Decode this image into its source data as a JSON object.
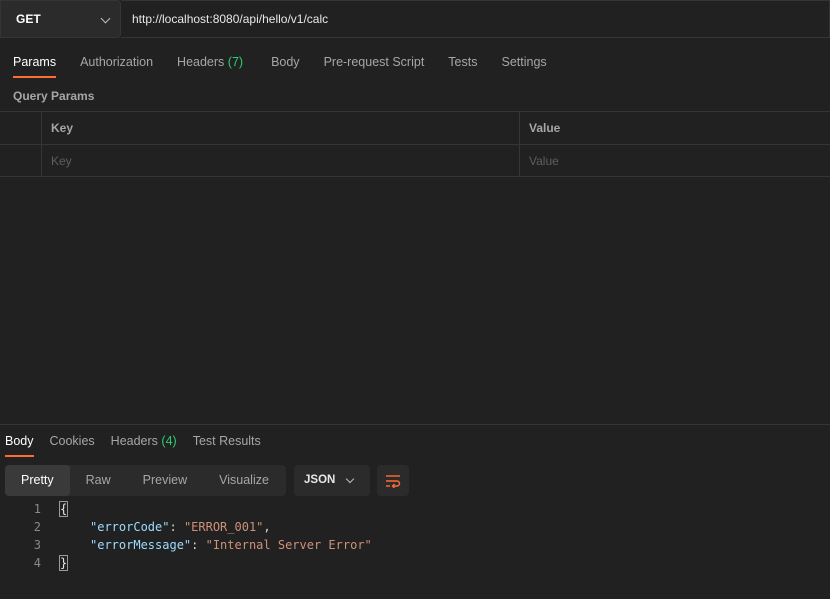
{
  "request": {
    "method": "GET",
    "url": "http://localhost:8080/api/hello/v1/calc"
  },
  "request_tabs": [
    {
      "label": "Params",
      "count": "",
      "active": true
    },
    {
      "label": "Authorization",
      "count": "",
      "active": false
    },
    {
      "label": "Headers",
      "count": "(7)",
      "active": false
    },
    {
      "label": "Body",
      "count": "",
      "active": false
    },
    {
      "label": "Pre-request Script",
      "count": "",
      "active": false
    },
    {
      "label": "Tests",
      "count": "",
      "active": false
    },
    {
      "label": "Settings",
      "count": "",
      "active": false
    }
  ],
  "query_params": {
    "section_label": "Query Params",
    "columns": [
      "Key",
      "Value"
    ],
    "placeholders": {
      "key": "Key",
      "value": "Value"
    }
  },
  "response_tabs": [
    {
      "label": "Body",
      "count": "",
      "active": true
    },
    {
      "label": "Cookies",
      "count": "",
      "active": false
    },
    {
      "label": "Headers",
      "count": "(4)",
      "active": false
    },
    {
      "label": "Test Results",
      "count": "",
      "active": false
    }
  ],
  "view_modes": [
    {
      "label": "Pretty",
      "active": true
    },
    {
      "label": "Raw",
      "active": false
    },
    {
      "label": "Preview",
      "active": false
    },
    {
      "label": "Visualize",
      "active": false
    }
  ],
  "format": "JSON",
  "response_body": {
    "line_numbers": [
      "1",
      "2",
      "3",
      "4"
    ],
    "open_brace": "{",
    "close_brace": "}",
    "fields": [
      {
        "key": "\"errorCode\"",
        "value": "\"ERROR_001\"",
        "trailing": ","
      },
      {
        "key": "\"errorMessage\"",
        "value": "\"Internal Server Error\"",
        "trailing": ""
      }
    ]
  },
  "colors": {
    "accent": "#ff6c37",
    "count": "#2ecc71",
    "json_key": "#9cdcfe",
    "json_string": "#ce9178",
    "background": "#212121"
  },
  "icons": {
    "method_dropdown": "chevron-down-icon",
    "format_dropdown": "chevron-down-icon",
    "wrap": "text-wrap-icon"
  }
}
